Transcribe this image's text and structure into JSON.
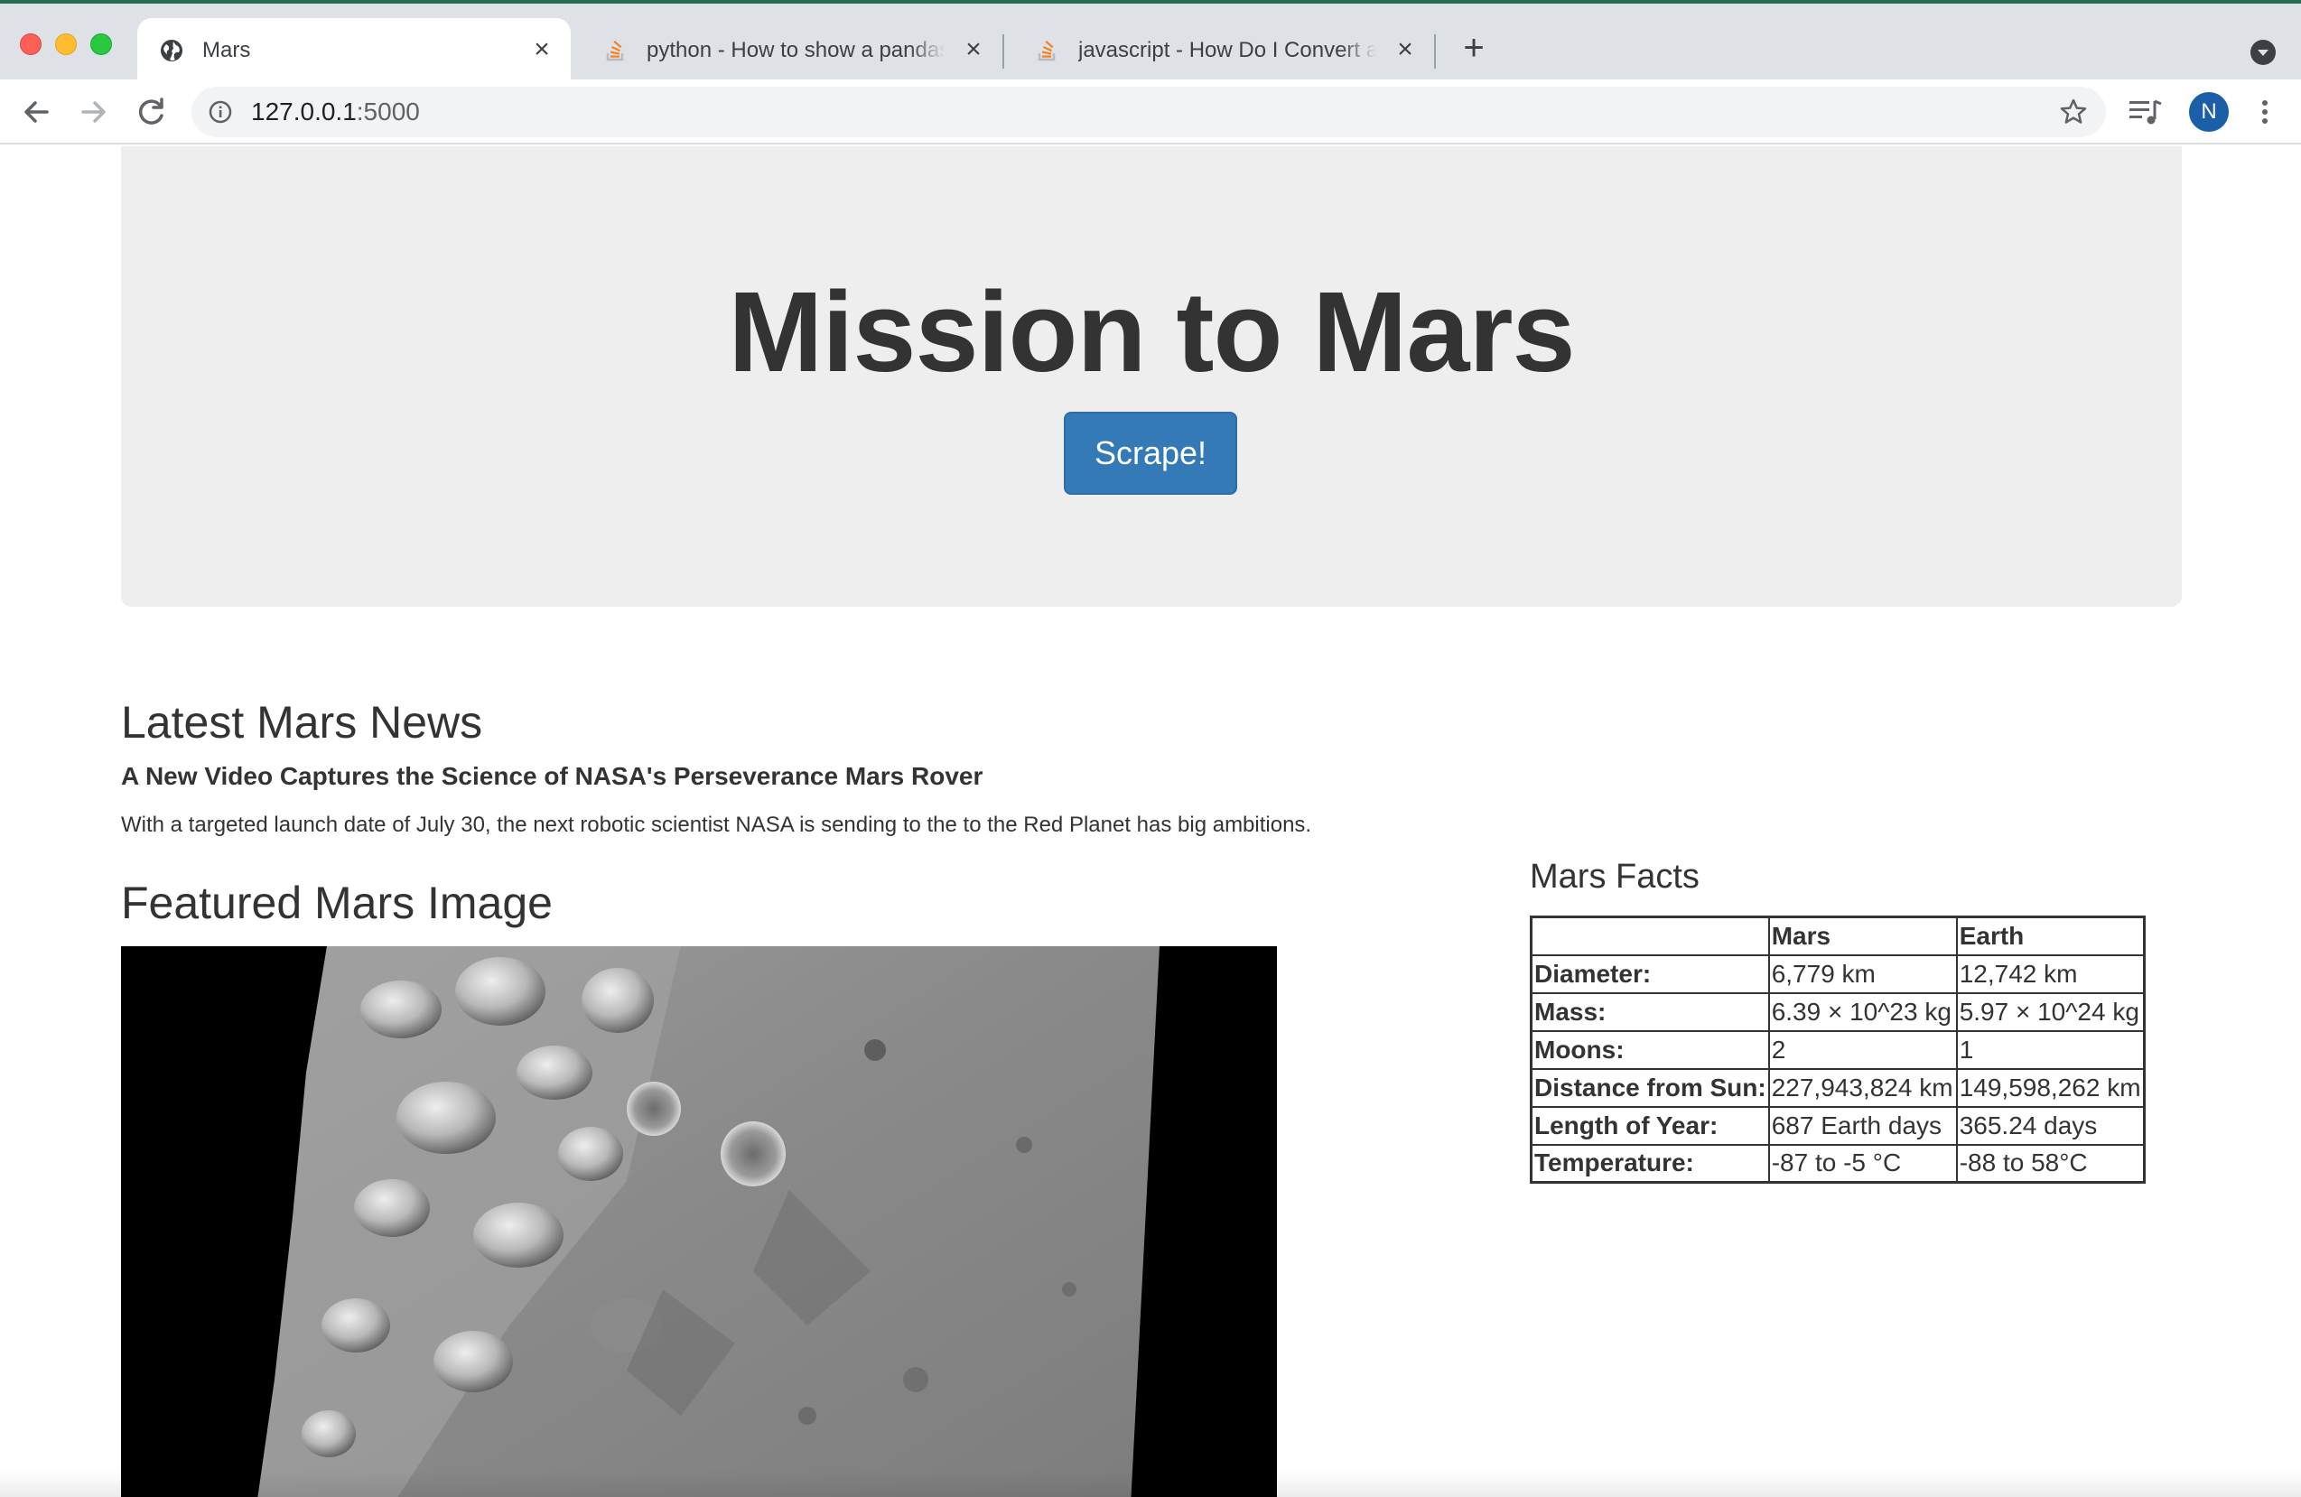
{
  "browser": {
    "tabs": [
      {
        "title": "Mars",
        "favicon": "globe-icon",
        "active": true
      },
      {
        "title": "python - How to show a pandas dataframe into a existing",
        "favicon": "stackoverflow-icon",
        "active": false
      },
      {
        "title": "javascript - How Do I Convert a Pandas Dataframe",
        "favicon": "stackoverflow-icon",
        "active": false
      }
    ],
    "url_host": "127.0.0.1",
    "url_port": ":5000",
    "profile_initial": "N",
    "accent_color": "#1a5fa8"
  },
  "page": {
    "heading": "Mission to Mars",
    "scrape_label": "Scrape!",
    "button_color": "#337ab7",
    "news": {
      "heading": "Latest Mars News",
      "title": "A New Video Captures the Science of NASA's Perseverance Mars Rover",
      "paragraph": "With a targeted launch date of July 30, the next robotic scientist NASA is sending to the to the Red Planet has big ambitions."
    },
    "featured_image": {
      "heading": "Featured Mars Image"
    },
    "facts": {
      "heading": "Mars Facts",
      "columns": [
        "",
        "Mars",
        "Earth"
      ],
      "rows": [
        [
          "Diameter:",
          "6,779 km",
          "12,742 km"
        ],
        [
          "Mass:",
          "6.39 × 10^23 kg",
          "5.97 × 10^24 kg"
        ],
        [
          "Moons:",
          "2",
          "1"
        ],
        [
          "Distance from Sun:",
          "227,943,824 km",
          "149,598,262 km"
        ],
        [
          "Length of Year:",
          "687 Earth days",
          "365.24 days"
        ],
        [
          "Temperature:",
          "-87 to -5 °C",
          "-88 to 58°C"
        ]
      ]
    }
  }
}
